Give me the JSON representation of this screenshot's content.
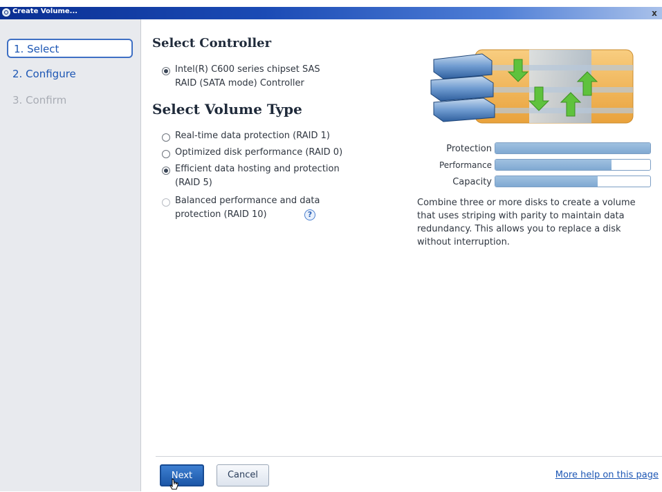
{
  "window": {
    "title": "Create Volume...",
    "close_glyph": "x"
  },
  "steps": [
    {
      "label": "1. Select",
      "state": "active"
    },
    {
      "label": "2. Configure",
      "state": "enabled"
    },
    {
      "label": "3. Confirm",
      "state": "disabled"
    }
  ],
  "controller": {
    "heading": "Select Controller",
    "options": [
      {
        "label_line1": "Intel(R) C600 series chipset SAS",
        "label_line2": "RAID (SATA mode) Controller",
        "checked": true
      }
    ]
  },
  "volume_type": {
    "heading": "Select Volume Type",
    "options": [
      {
        "label_line1": "Real-time data protection (RAID 1)",
        "label_line2": "",
        "checked": false
      },
      {
        "label_line1": "Optimized disk performance (RAID 0)",
        "label_line2": "",
        "checked": false
      },
      {
        "label_line1": "Efficient data hosting and protection",
        "label_line2": "(RAID 5)",
        "checked": true
      },
      {
        "label_line1": "Balanced performance and data",
        "label_line2": "protection (RAID 10)",
        "checked": false
      }
    ],
    "help_icon": "help-icon",
    "help_glyph": "?"
  },
  "meters": [
    {
      "label": "Protection",
      "value": 1.0
    },
    {
      "label": "Performance",
      "value": 0.75
    },
    {
      "label": "Capacity",
      "value": 0.66
    }
  ],
  "description": "Combine three or more disks to create a volume that uses striping with parity to maintain data redundancy. This allows you to replace a disk without interruption.",
  "footer": {
    "next_label": "Next",
    "cancel_label": "Cancel",
    "help_link": "More help on this page"
  },
  "colors": {
    "title_bar": "#0a2f93",
    "link": "#1c56b4",
    "meter_fill": "#80a9d2",
    "disk_orange": "#f2b04a",
    "disk_blue": "#4f7fb8",
    "arrow_green": "#5fc23d"
  }
}
